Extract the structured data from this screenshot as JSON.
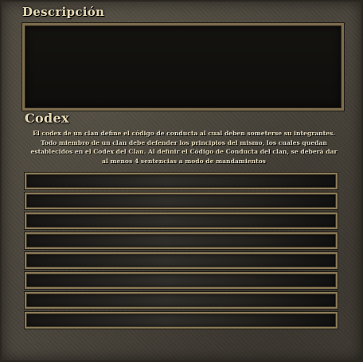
{
  "description": {
    "title": "Descripción",
    "value": ""
  },
  "codex": {
    "title": "Codex",
    "text": "El codex de un clan define el código de conducta al cual deben someterse su integrantes. Todo miembro de un clan debe defender los principios del mismo, los cuales quedan establecidos en el Codex del Clan. Al definir el Código de Conducta del clan, se deberá dar al menos 4 sentencias a modo de mandamientos",
    "rules": [
      "",
      "",
      "",
      "",
      "",
      "",
      "",
      ""
    ]
  }
}
